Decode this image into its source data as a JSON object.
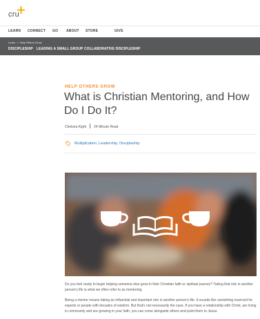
{
  "brand": {
    "logo_text": "cru",
    "accent": "#f2a900"
  },
  "nav": {
    "items": [
      {
        "label": "LEARN"
      },
      {
        "label": "CONNECT"
      },
      {
        "label": "GO"
      },
      {
        "label": "ABOUT"
      },
      {
        "label": "STORE"
      },
      {
        "label": "GIVE"
      }
    ]
  },
  "subnav": {
    "breadcrumb": {
      "root": "Learn",
      "sep": ">",
      "current": "Help Others Grow"
    },
    "links": [
      {
        "label": "DISCIPLESHIP"
      },
      {
        "label": "LEADING A SMALL GROUP"
      },
      {
        "label": "COLLABORATIVE DISCIPLESHIP"
      }
    ],
    "bg": "#58595b"
  },
  "article": {
    "kicker": "HELP OTHERS GROW",
    "kicker_color": "#f28c28",
    "title": "What is Christian Mentoring, and How Do I Do It?",
    "author": "Chelsea Kight",
    "read_time": "24 Minute Read",
    "tags": "Multiplication, Leadership, Discipleship",
    "tag_icon": "tag-icon",
    "hero_icon": "coffee-bible-coffee-icon",
    "paragraphs": [
      "Do you feel ready to begin helping someone else grow in their Christian faith or spiritual journey? Taking that role in another person's life is what we often refer to as mentoring.",
      "Being a mentor means taking an influential and important role in another person's life. It sounds like something reserved for experts or people with decades of wisdom. But that's not necessarily the case. If you have a relationship with Christ, are living in community and are growing in your faith, you can come alongside others and point them to Jesus."
    ]
  }
}
